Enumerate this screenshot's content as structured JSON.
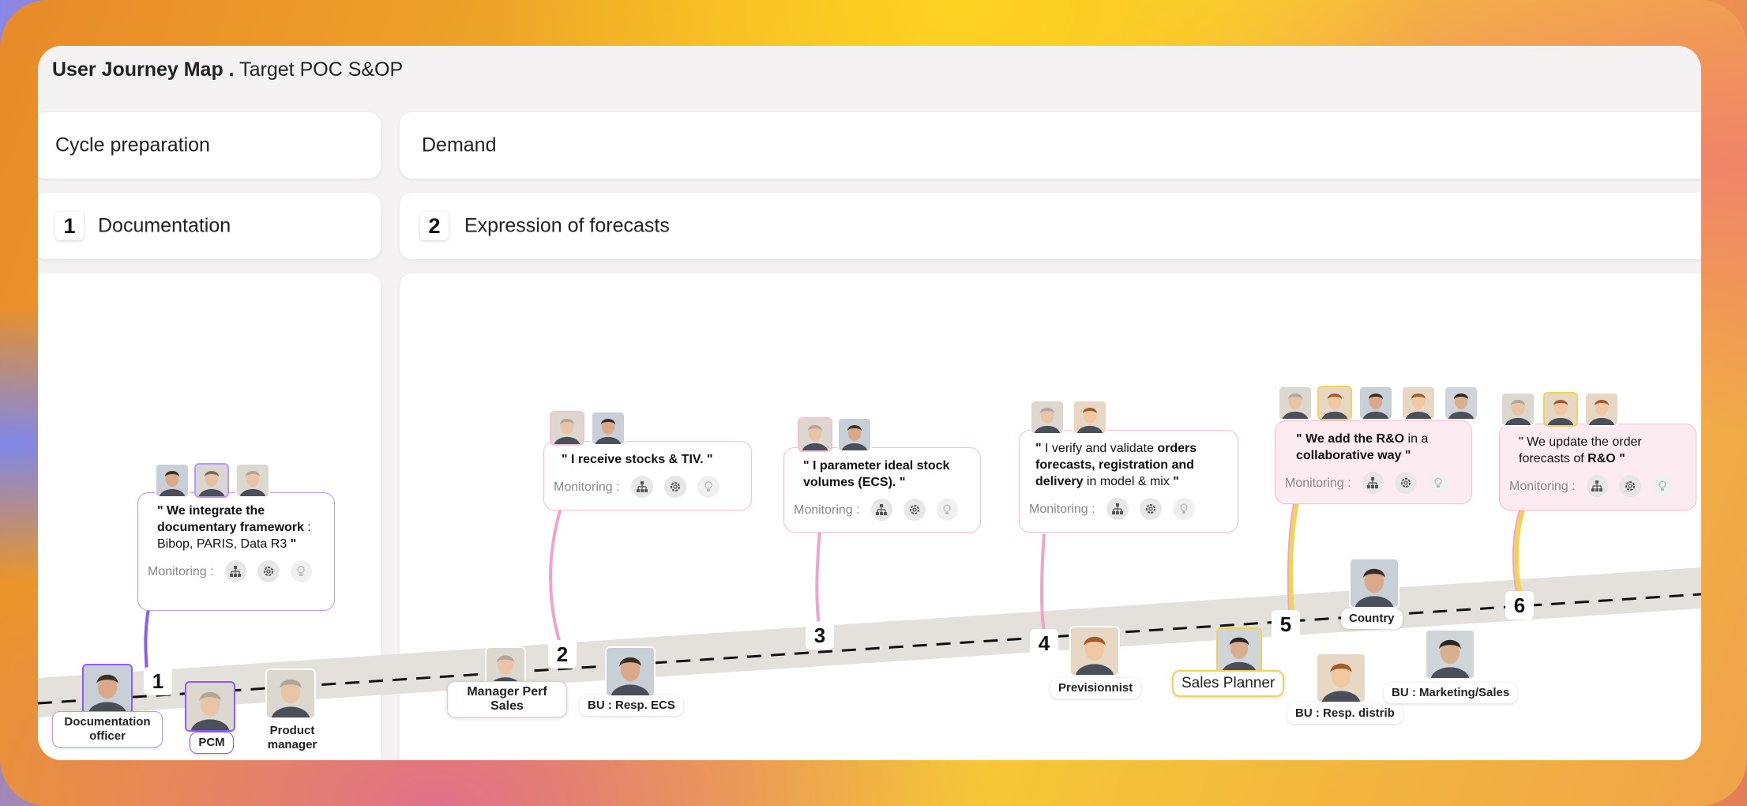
{
  "header": {
    "title_bold": "User Journey Map .",
    "title_rest": "Target POC  S&OP"
  },
  "phases": [
    {
      "label": "Cycle preparation"
    },
    {
      "label": "Demand"
    }
  ],
  "steps": [
    {
      "num": "1",
      "label": "Documentation"
    },
    {
      "num": "2",
      "label": "Expression of forecasts"
    }
  ],
  "monitoring_label": "Monitoring :",
  "bubbles": [
    {
      "parts": [
        "\" We ",
        "integrate the documentary framework",
        " : Bibop, PARIS, Data R3 ",
        "\""
      ]
    },
    {
      "parts": [
        "\" I ",
        "receive stocks & TIV.",
        " ",
        "\""
      ]
    },
    {
      "parts": [
        "\" I ",
        "parameter ideal stock volumes (ECS).",
        " ",
        "\""
      ]
    },
    {
      "parts": [
        "\" ",
        "",
        "I verify and validate  ",
        "orders forecasts, registration and delivery",
        " in model & mix ",
        "\""
      ]
    },
    {
      "parts": [
        "\" We ",
        "add the R&O",
        " in a ",
        "collaborative way",
        " ",
        "\""
      ]
    },
    {
      "parts": [
        "\" We update the order forecasts of ",
        "R&O",
        " ",
        "\""
      ]
    }
  ],
  "journey_numbers": [
    "1",
    "2",
    "3",
    "4",
    "5",
    "6"
  ],
  "roles": [
    {
      "label": "Documentation officer"
    },
    {
      "label": "PCM"
    },
    {
      "label": "Product manager"
    },
    {
      "label": "Manager Perf Sales"
    },
    {
      "label": "BU : Resp. ECS"
    },
    {
      "label": "Previsionnist"
    },
    {
      "label": "Sales Planner"
    },
    {
      "label": "Country"
    },
    {
      "label": "BU : Resp. distrib"
    },
    {
      "label": "BU : Marketing/Sales"
    }
  ],
  "icons": [
    "org-chart-icon",
    "gear-icon",
    "lightbulb-icon"
  ],
  "colors": {
    "purple": "#8b5cf6",
    "pink": "#f4a3c4",
    "yellow": "#f2d35a",
    "band": "#e4e0dc"
  }
}
